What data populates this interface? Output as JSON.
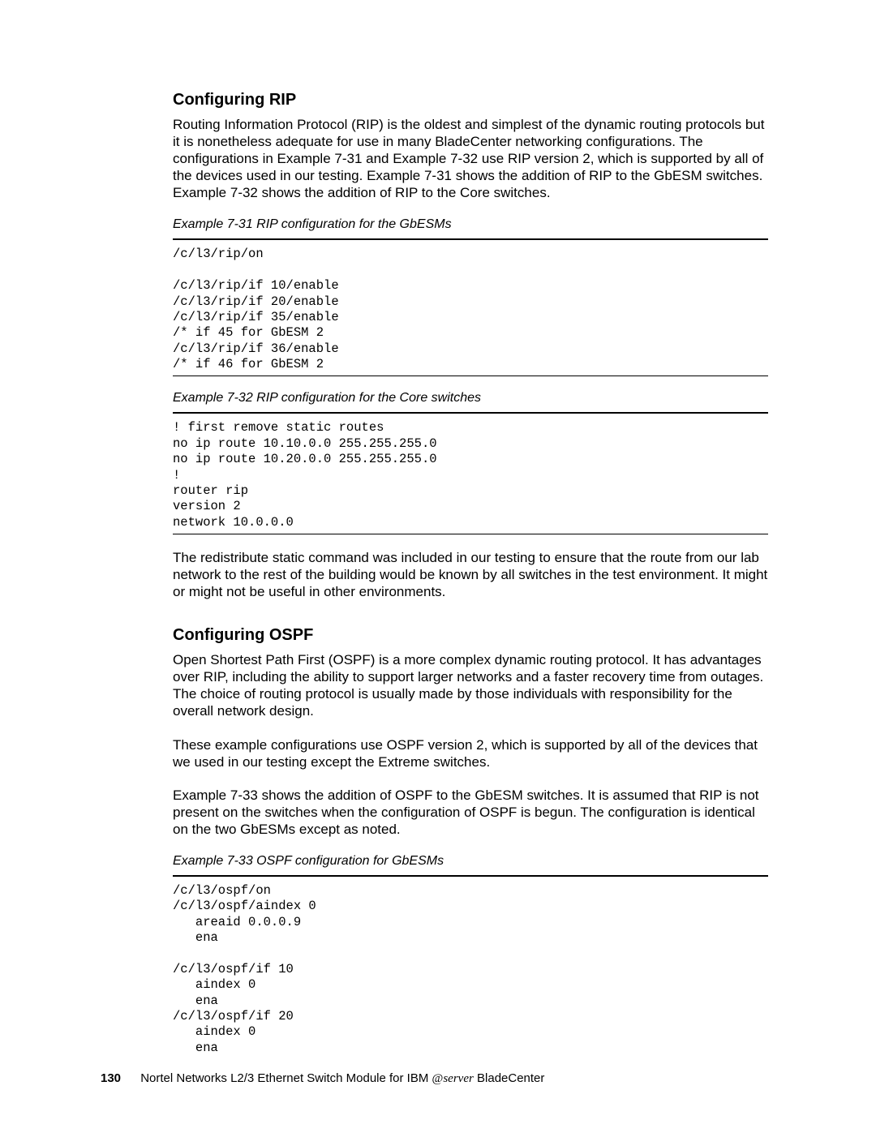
{
  "sections": {
    "rip": {
      "heading": "Configuring RIP",
      "para1": "Routing Information Protocol (RIP) is the oldest and simplest of the dynamic routing protocols but it is nonetheless adequate for use in many BladeCenter networking configurations. The configurations in Example 7-31 and Example 7-32 use RIP version 2, which is supported by all of the devices used in our testing. Example 7-31 shows the addition of RIP to the GbESM switches. Example 7-32 shows the addition of RIP to the Core switches.",
      "example31_caption": "Example 7-31   RIP configuration for the GbESMs",
      "example31_code": "/c/l3/rip/on\n\n/c/l3/rip/if 10/enable\n/c/l3/rip/if 20/enable\n/c/l3/rip/if 35/enable\n/* if 45 for GbESM 2\n/c/l3/rip/if 36/enable\n/* if 46 for GbESM 2",
      "example32_caption": "Example 7-32   RIP configuration for the Core switches",
      "example32_code": "! first remove static routes\nno ip route 10.10.0.0 255.255.255.0\nno ip route 10.20.0.0 255.255.255.0\n!\nrouter rip\nversion 2\nnetwork 10.0.0.0",
      "para_after": "The redistribute static command was included in our testing to ensure that the route from our lab network to the rest of the building would be known by all switches in the test environment. It might or might not be useful in other environments."
    },
    "ospf": {
      "heading": "Configuring OSPF",
      "para1": "Open Shortest Path First (OSPF) is a more complex dynamic routing protocol. It has advantages over RIP, including the ability to support larger networks and a faster recovery time from outages. The choice of routing protocol is usually made by those individuals with responsibility for the overall network design.",
      "para2": "These example configurations use OSPF version 2, which is supported by all of the devices that we used in our testing except the Extreme switches.",
      "para3": "Example 7-33 shows the addition of OSPF to the GbESM switches. It is assumed that RIP is not present on the switches when the configuration of OSPF is begun. The configuration is identical on the two GbESMs except as noted.",
      "example33_caption": "Example 7-33   OSPF configuration for GbESMs",
      "example33_code": "/c/l3/ospf/on\n/c/l3/ospf/aindex 0\n   areaid 0.0.0.9\n   ena\n\n/c/l3/ospf/if 10\n   aindex 0\n   ena\n/c/l3/ospf/if 20\n   aindex 0\n   ena"
    }
  },
  "footer": {
    "page_number": "130",
    "title_prefix": "Nortel Networks L2/3 Ethernet Switch Module for IBM ",
    "title_suffix": " BladeCenter",
    "logo_at": "@",
    "logo_word": "server"
  }
}
